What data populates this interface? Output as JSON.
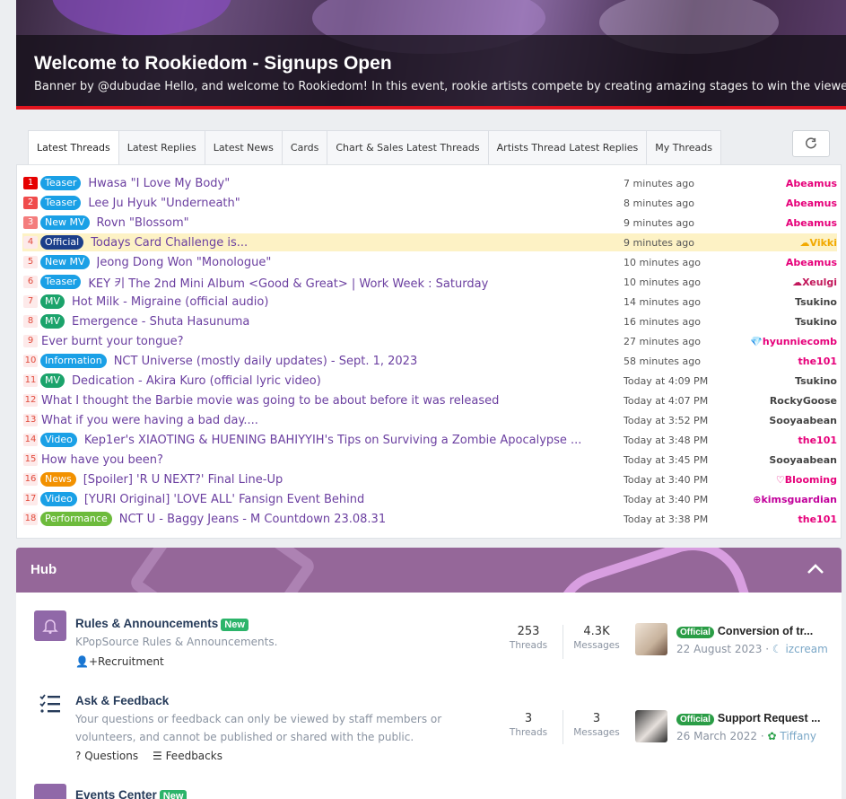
{
  "banner": {
    "title": "Welcome to Rookiedom - Signups Open",
    "text": "Banner by @dubudae Hello, and welcome to Rookiedom! In this event, rookie artists compete by creating amazing stages to win the viewers' attention and votes."
  },
  "tabs": [
    {
      "label": "Latest Threads",
      "active": true
    },
    {
      "label": "Latest Replies"
    },
    {
      "label": "Latest News"
    },
    {
      "label": "Cards"
    },
    {
      "label": "Chart & Sales Latest Threads"
    },
    {
      "label": "Artists Thread Latest Replies"
    },
    {
      "label": "My Threads"
    }
  ],
  "refresh_icon": "refresh-icon",
  "threads": [
    {
      "n": "1",
      "label": "Teaser",
      "label_color": "#1aa0e6",
      "title": "Hwasa \"I Love My Body\"",
      "time": "7 minutes ago",
      "user": "Abeamus",
      "user_color": "#e6007a"
    },
    {
      "n": "2",
      "label": "Teaser",
      "label_color": "#1aa0e6",
      "title": "Lee Ju Hyuk \"Underneath\"",
      "time": "8 minutes ago",
      "user": "Abeamus",
      "user_color": "#e6007a"
    },
    {
      "n": "3",
      "label": "New MV",
      "label_color": "#1aa0e6",
      "title": "Rovn \"Blossom\"",
      "time": "9 minutes ago",
      "user": "Abeamus",
      "user_color": "#e6007a"
    },
    {
      "n": "4",
      "label": "Official",
      "label_color": "#1b3e8a",
      "title": "Todays Card Challenge is...",
      "time": "9 minutes ago",
      "user": "Vikki",
      "user_color": "#f2a900",
      "user_prefix": "☁",
      "highlight": true
    },
    {
      "n": "5",
      "label": "New MV",
      "label_color": "#1aa0e6",
      "title": "Jeong Dong Won \"Monologue\"",
      "time": "10 minutes ago",
      "user": "Abeamus",
      "user_color": "#e6007a"
    },
    {
      "n": "6",
      "label": "Teaser",
      "label_color": "#1aa0e6",
      "title": "KEY 키 The 2nd Mini Album <Good & Great> | Work Week : Saturday",
      "time": "10 minutes ago",
      "user": "Xeulgi",
      "user_color": "#c2185b",
      "user_prefix": "☁"
    },
    {
      "n": "7",
      "label": "MV",
      "label_color": "#1ba36b",
      "title": "Hot Milk - Migraine (official audio)",
      "time": "14 minutes ago",
      "user": "Tsukino",
      "user_color": "#444"
    },
    {
      "n": "8",
      "label": "MV",
      "label_color": "#1ba36b",
      "title": "Emergence - Shuta Hasunuma",
      "time": "16 minutes ago",
      "user": "Tsukino",
      "user_color": "#444"
    },
    {
      "n": "9",
      "label": "",
      "label_color": "",
      "title": "Ever burnt your tongue?",
      "time": "27 minutes ago",
      "user": "hyunniecomb",
      "user_color": "#e6007a",
      "user_prefix": "💎"
    },
    {
      "n": "10",
      "label": "Information",
      "label_color": "#1aa0e6",
      "title": "NCT Universe (mostly daily updates) - Sept. 1, 2023",
      "time": "58 minutes ago",
      "user": "the101",
      "user_color": "#e6007a"
    },
    {
      "n": "11",
      "label": "MV",
      "label_color": "#1ba36b",
      "title": "Dedication - Akira Kuro (official lyric video)",
      "time": "Today at 4:09 PM",
      "user": "Tsukino",
      "user_color": "#444"
    },
    {
      "n": "12",
      "label": "",
      "label_color": "",
      "title": "What I thought the Barbie movie was going to be about before it was released",
      "time": "Today at 4:07 PM",
      "user": "RockyGoose",
      "user_color": "#444"
    },
    {
      "n": "13",
      "label": "",
      "label_color": "",
      "title": "What if you were having a bad day....",
      "time": "Today at 3:52 PM",
      "user": "Sooyaabean",
      "user_color": "#444"
    },
    {
      "n": "14",
      "label": "Video",
      "label_color": "#1aa0e6",
      "title": "Kep1er's XIAOTING & HUENING BAHIYYIH's Tips on Surviving a Zombie Apocalypse ...",
      "time": "Today at 3:48 PM",
      "user": "the101",
      "user_color": "#e6007a"
    },
    {
      "n": "15",
      "label": "",
      "label_color": "",
      "title": "How have you been?",
      "time": "Today at 3:45 PM",
      "user": "Sooyaabean",
      "user_color": "#444"
    },
    {
      "n": "16",
      "label": "News",
      "label_color": "#f29100",
      "title": "[Spoiler] 'R U NEXT?' Final Line-Up",
      "time": "Today at 3:40 PM",
      "user": "Blooming",
      "user_color": "#e6007a",
      "user_prefix": "♡"
    },
    {
      "n": "17",
      "label": "Video",
      "label_color": "#1aa0e6",
      "title": "[YURI Original] 'LOVE ALL' Fansign Event Behind",
      "time": "Today at 3:40 PM",
      "user": "kimsguardian",
      "user_color": "#c2009b",
      "user_prefix": "⊕"
    },
    {
      "n": "18",
      "label": "Performance",
      "label_color": "#6dbb3c",
      "title": "NCT U - Baggy Jeans - M Countdown 23.08.31",
      "time": "Today at 3:38 PM",
      "user": "the101",
      "user_color": "#e6007a"
    }
  ],
  "hub": {
    "title": "Hub",
    "nodes": [
      {
        "title": "Rules & Announcements",
        "badge": "New",
        "desc": "KPopSource Rules & Announcements.",
        "sub": [
          "Recruitment"
        ],
        "threads": "253",
        "threads_label": "Threads",
        "messages": "4.3K",
        "messages_label": "Messages",
        "last_badge": "Official",
        "last_title": "Conversion of tr...",
        "last_date": "22 August 2023",
        "last_user": "izcream",
        "icon": "bell-icon"
      },
      {
        "title": "Ask & Feedback",
        "badge": "",
        "desc": "Your questions or feedback can only be viewed by staff members or volunteers, and cannot be published or shared with the public.",
        "sub": [
          "Questions",
          "Feedbacks"
        ],
        "threads": "3",
        "threads_label": "Threads",
        "messages": "3",
        "messages_label": "Messages",
        "last_badge": "Official",
        "last_title": "Support Request ...",
        "last_date": "26 March 2022",
        "last_user": "Tiffany",
        "icon": "list-icon"
      },
      {
        "title": "Events Center",
        "badge": "New",
        "icon": "events-icon"
      }
    ]
  }
}
